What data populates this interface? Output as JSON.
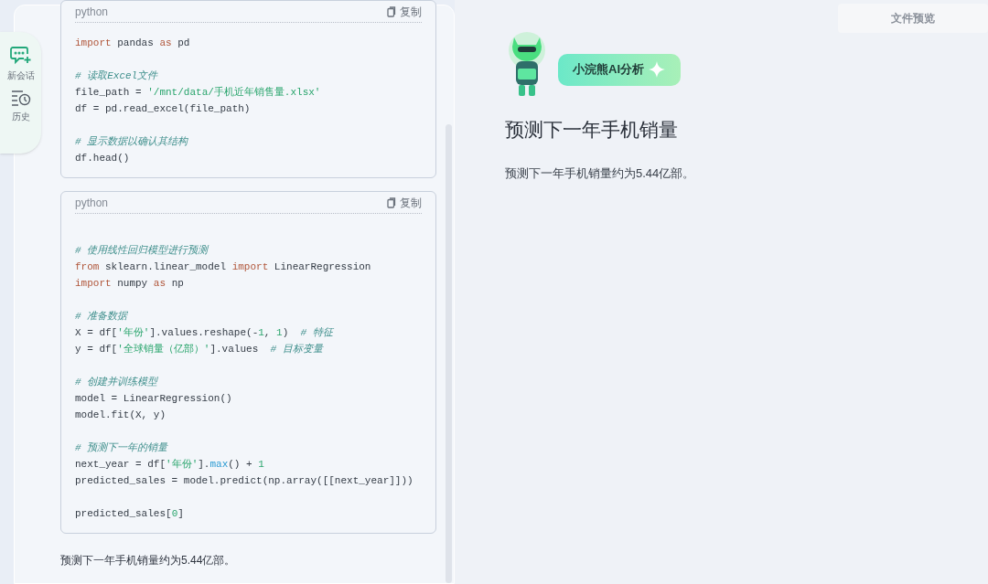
{
  "side_nav": [
    {
      "label": "新会话",
      "kind": "new-chat"
    },
    {
      "label": "历史",
      "kind": "history"
    }
  ],
  "code_blocks": [
    {
      "language": "python",
      "copy_label": "复制",
      "lines": [
        {
          "kind": "code",
          "tokens": [
            {
              "text": "import",
              "kind": "kw"
            },
            {
              "text": " pandas ",
              "kind": "plain"
            },
            {
              "text": "as",
              "kind": "kw"
            },
            {
              "text": " pd",
              "kind": "plain"
            }
          ]
        },
        {
          "kind": "blank"
        },
        {
          "kind": "code",
          "tokens": [
            {
              "text": "# 读取Excel文件",
              "kind": "comment"
            }
          ]
        },
        {
          "kind": "code",
          "tokens": [
            {
              "text": "file_path = ",
              "kind": "plain"
            },
            {
              "text": "'/mnt/data/手机近年销售量.xlsx'",
              "kind": "str"
            }
          ]
        },
        {
          "kind": "code",
          "tokens": [
            {
              "text": "df = pd.read_excel(file_path)",
              "kind": "plain"
            }
          ]
        },
        {
          "kind": "blank"
        },
        {
          "kind": "code",
          "tokens": [
            {
              "text": "# 显示数据以确认其结构",
              "kind": "comment"
            }
          ]
        },
        {
          "kind": "code",
          "tokens": [
            {
              "text": "df.head()",
              "kind": "plain"
            }
          ]
        }
      ]
    },
    {
      "language": "python",
      "copy_label": "复制",
      "lines": [
        {
          "kind": "blank"
        },
        {
          "kind": "code",
          "tokens": [
            {
              "text": "# 使用线性回归模型进行预测",
              "kind": "comment"
            }
          ]
        },
        {
          "kind": "code",
          "tokens": [
            {
              "text": "from",
              "kind": "kw"
            },
            {
              "text": " sklearn.linear_model ",
              "kind": "plain"
            },
            {
              "text": "import",
              "kind": "kw"
            },
            {
              "text": " LinearRegression",
              "kind": "plain"
            }
          ]
        },
        {
          "kind": "code",
          "tokens": [
            {
              "text": "import",
              "kind": "kw"
            },
            {
              "text": " numpy ",
              "kind": "plain"
            },
            {
              "text": "as",
              "kind": "kw"
            },
            {
              "text": " np",
              "kind": "plain"
            }
          ]
        },
        {
          "kind": "blank"
        },
        {
          "kind": "code",
          "tokens": [
            {
              "text": "# 准备数据",
              "kind": "comment"
            }
          ]
        },
        {
          "kind": "code",
          "tokens": [
            {
              "text": "X = df[",
              "kind": "plain"
            },
            {
              "text": "'年份'",
              "kind": "str"
            },
            {
              "text": "].values.reshape(-",
              "kind": "plain"
            },
            {
              "text": "1",
              "kind": "num"
            },
            {
              "text": ", ",
              "kind": "plain"
            },
            {
              "text": "1",
              "kind": "num"
            },
            {
              "text": ")  ",
              "kind": "plain"
            },
            {
              "text": "# 特征",
              "kind": "comment"
            }
          ]
        },
        {
          "kind": "code",
          "tokens": [
            {
              "text": "y = df[",
              "kind": "plain"
            },
            {
              "text": "'全球销量（亿部）'",
              "kind": "str"
            },
            {
              "text": "].values  ",
              "kind": "plain"
            },
            {
              "text": "# 目标变量",
              "kind": "comment"
            }
          ]
        },
        {
          "kind": "blank"
        },
        {
          "kind": "code",
          "tokens": [
            {
              "text": "# 创建并训练模型",
              "kind": "comment"
            }
          ]
        },
        {
          "kind": "code",
          "tokens": [
            {
              "text": "model = LinearRegression()",
              "kind": "plain"
            }
          ]
        },
        {
          "kind": "code",
          "tokens": [
            {
              "text": "model.fit(X, y)",
              "kind": "plain"
            }
          ]
        },
        {
          "kind": "blank"
        },
        {
          "kind": "code",
          "tokens": [
            {
              "text": "# 预测下一年的销量",
              "kind": "comment"
            }
          ]
        },
        {
          "kind": "code",
          "tokens": [
            {
              "text": "next_year = df[",
              "kind": "plain"
            },
            {
              "text": "'年份'",
              "kind": "str"
            },
            {
              "text": "].",
              "kind": "plain"
            },
            {
              "text": "max",
              "kind": "fn"
            },
            {
              "text": "() + ",
              "kind": "plain"
            },
            {
              "text": "1",
              "kind": "num"
            }
          ]
        },
        {
          "kind": "code",
          "tokens": [
            {
              "text": "predicted_sales = model.predict(np.array([[next_year]]))",
              "kind": "plain"
            }
          ]
        },
        {
          "kind": "blank"
        },
        {
          "kind": "code",
          "tokens": [
            {
              "text": "predicted_sales[",
              "kind": "plain"
            },
            {
              "text": "0",
              "kind": "num"
            },
            {
              "text": "]",
              "kind": "plain"
            }
          ]
        }
      ]
    }
  ],
  "chat_answer": "预测下一年手机销量约为5.44亿部。",
  "preview": {
    "button": "文件预览",
    "badge": "小浣熊AI分析",
    "title": "预测下一年手机销量",
    "answer": "预测下一年手机销量约为5.44亿部。"
  }
}
